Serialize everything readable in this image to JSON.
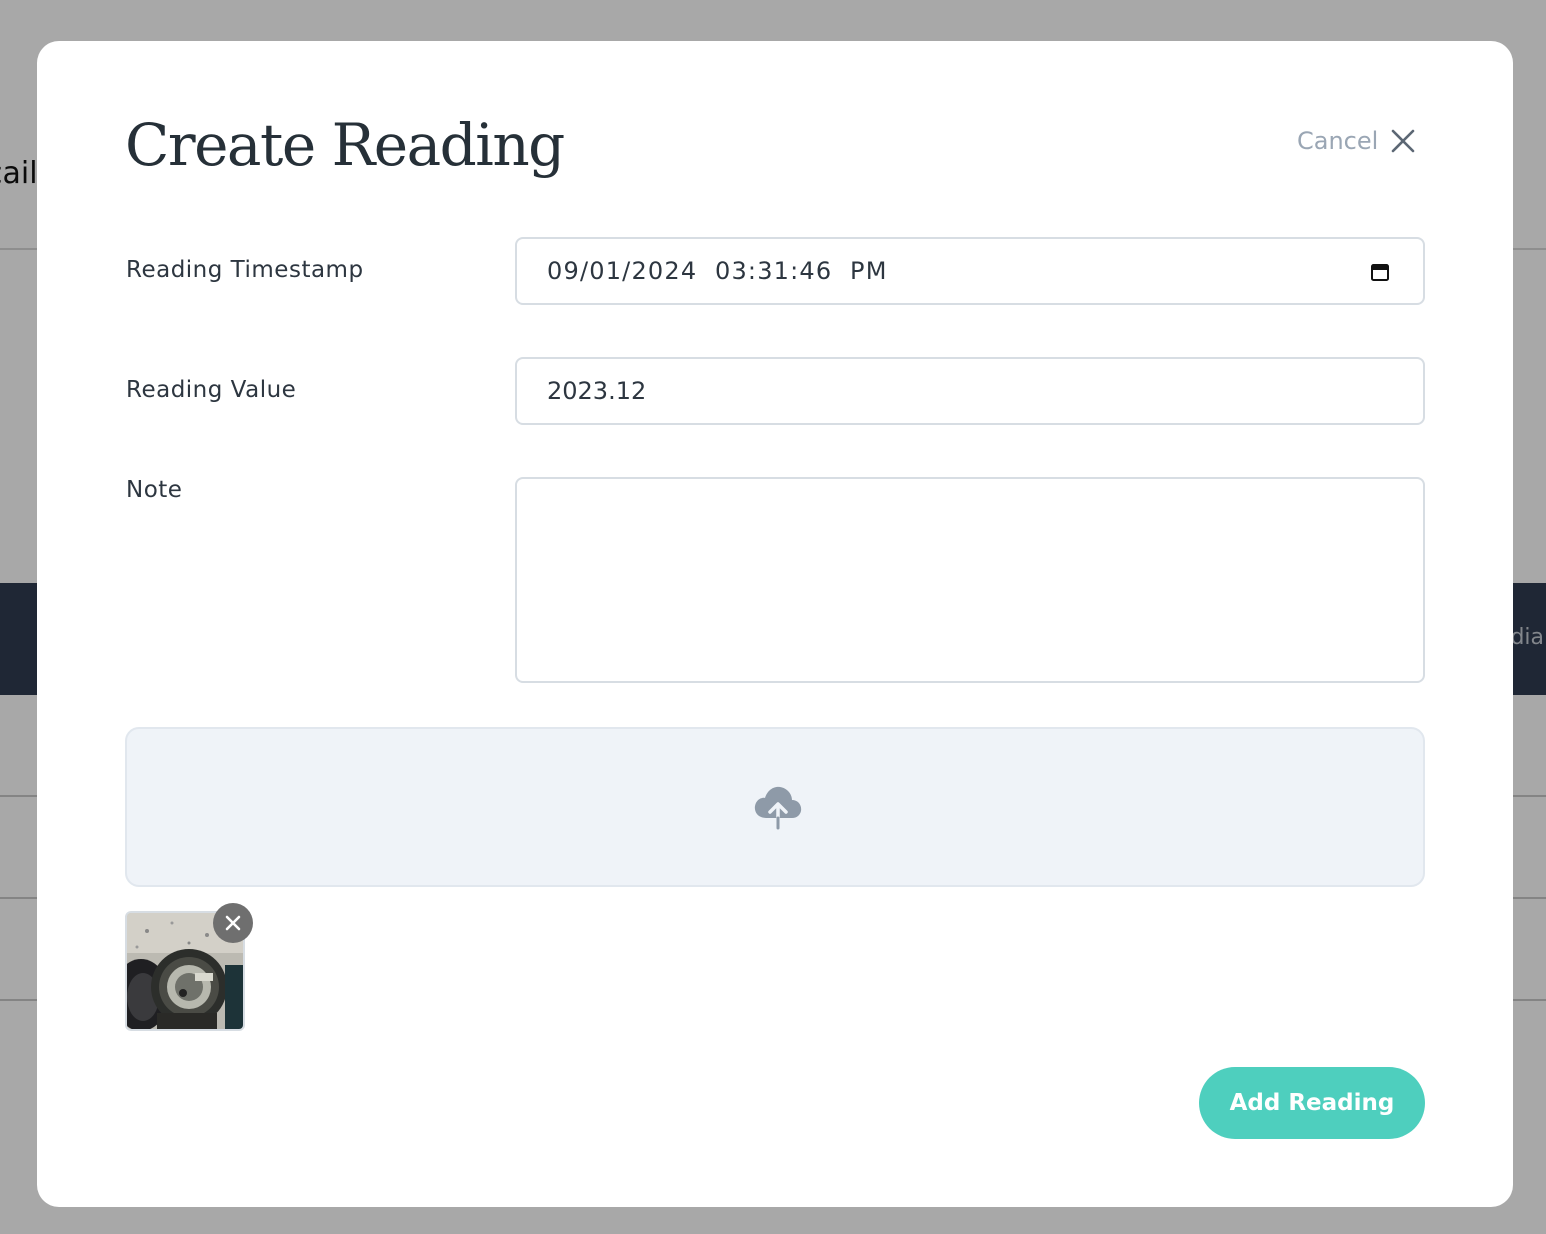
{
  "background": {
    "page_title_fragment": "cail",
    "table_header_fragment": "dia"
  },
  "modal": {
    "title": "Create Reading",
    "cancel_label": "Cancel",
    "cancel_icon": "close-icon",
    "fields": {
      "timestamp": {
        "label": "Reading Timestamp",
        "value": "09/01/2024  03:31:46  PM",
        "icon": "calendar-icon"
      },
      "value": {
        "label": "Reading Value",
        "value": "2023.12"
      },
      "note": {
        "label": "Note",
        "value": ""
      }
    },
    "dropzone": {
      "icon": "cloud-upload-icon"
    },
    "attachments": [
      {
        "type": "photo",
        "subject": "water meter",
        "remove_icon": "remove-x-icon"
      }
    ],
    "submit_label": "Add Reading"
  },
  "colors": {
    "accent": "#4ecfbe",
    "title_text": "#263038",
    "muted_text": "#9aa6b4",
    "border": "#d7dde3",
    "dropzone_bg": "#eff3f8"
  }
}
